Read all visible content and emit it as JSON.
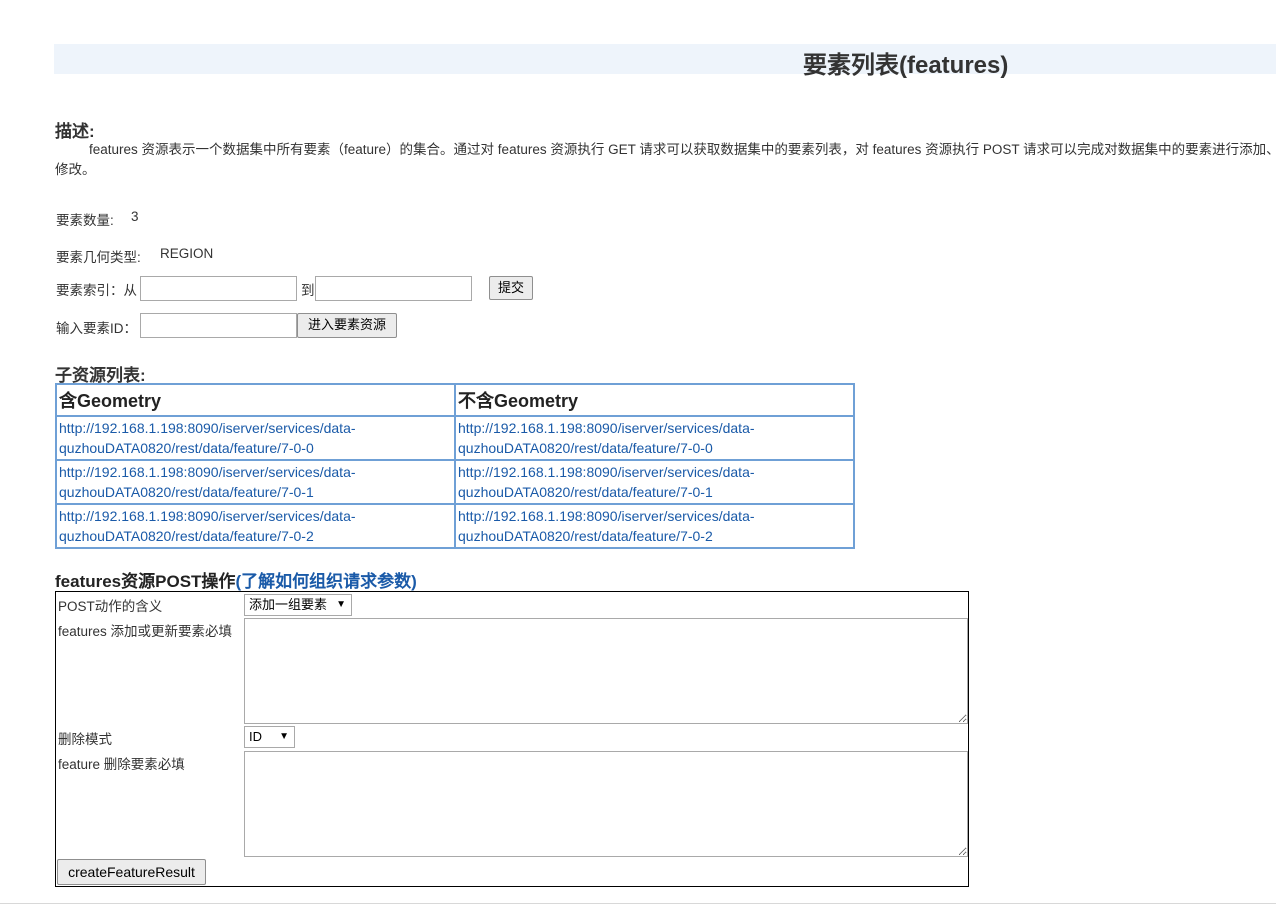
{
  "page": {
    "title": "要素列表(features)"
  },
  "description": {
    "heading": "描述:",
    "line1": "features 资源表示一个数据集中所有要素（feature）的集合。通过对 features 资源执行 GET 请求可以获取数据集中的要素列表，对 features 资源执行 POST 请求可以完成对数据集中的要素进行添加、删除、修改。",
    "line2": "修改。"
  },
  "info": {
    "count_label": "要素数量:",
    "count_value": "3",
    "geom_label": "要素几何类型:",
    "geom_value": "REGION"
  },
  "index_form": {
    "label": "要素索引：从",
    "from_value": "",
    "to_label": "到",
    "to_value": "",
    "submit_label": "提交"
  },
  "id_form": {
    "label": "输入要素ID：",
    "id_value": "",
    "enter_label": "进入要素资源"
  },
  "children": {
    "heading": "子资源列表:",
    "columns": [
      "含Geometry",
      "不含Geometry"
    ],
    "rows": [
      {
        "with_geometry": "http://192.168.1.198:8090/iserver/services/data-quzhouDATA0820/rest/data/feature/7-0-0",
        "without_geometry": "http://192.168.1.198:8090/iserver/services/data-quzhouDATA0820/rest/data/feature/7-0-0"
      },
      {
        "with_geometry": "http://192.168.1.198:8090/iserver/services/data-quzhouDATA0820/rest/data/feature/7-0-1",
        "without_geometry": "http://192.168.1.198:8090/iserver/services/data-quzhouDATA0820/rest/data/feature/7-0-1"
      },
      {
        "with_geometry": "http://192.168.1.198:8090/iserver/services/data-quzhouDATA0820/rest/data/feature/7-0-2",
        "without_geometry": "http://192.168.1.198:8090/iserver/services/data-quzhouDATA0820/rest/data/feature/7-0-2"
      }
    ]
  },
  "post": {
    "heading": "features资源POST操作",
    "help_link": "(了解如何组织请求参数)",
    "action_label": "POST动作的含义",
    "action_selected": "添加一组要素",
    "features_label": "features 添加或更新要素必填",
    "features_value": "",
    "delete_mode_label": "删除模式",
    "delete_mode_selected": "ID",
    "feature_label": "feature 删除要素必填",
    "feature_value": "",
    "submit_label": "createFeatureResult"
  }
}
